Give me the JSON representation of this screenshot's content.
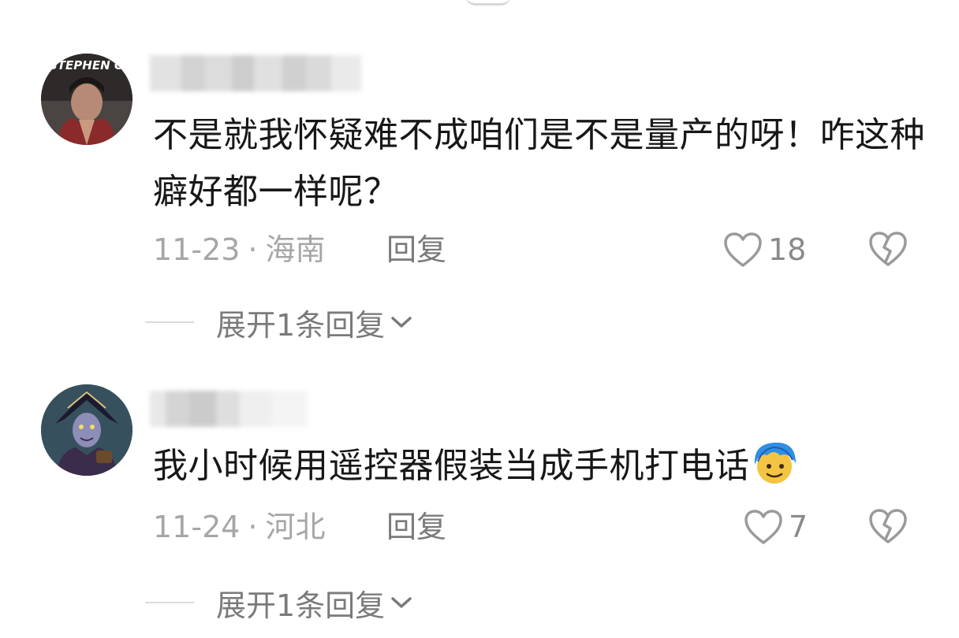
{
  "comments": [
    {
      "avatar_text": "STEPHEN CHOW",
      "text": "不是就我怀疑难不成咱们是不是量产的呀！咋这种癖好都一样呢？",
      "date": "11-23",
      "separator": "·",
      "location": "海南",
      "reply_label": "回复",
      "likes": "18",
      "expand_label": "展开1条回复"
    },
    {
      "text": "我小时候用遥控器假装当成手机打电话",
      "emoji": "blue-hair-face-emoji",
      "date": "11-24",
      "separator": "·",
      "location": "河北",
      "reply_label": "回复",
      "likes": "7",
      "expand_label": "展开1条回复"
    }
  ],
  "icons": {
    "like": "heart-outline-icon",
    "dislike": "broken-heart-icon",
    "expand": "chevron-down-icon"
  },
  "colors": {
    "text": "#171717",
    "meta": "#a6a6a6",
    "action": "#7a7a7a"
  }
}
